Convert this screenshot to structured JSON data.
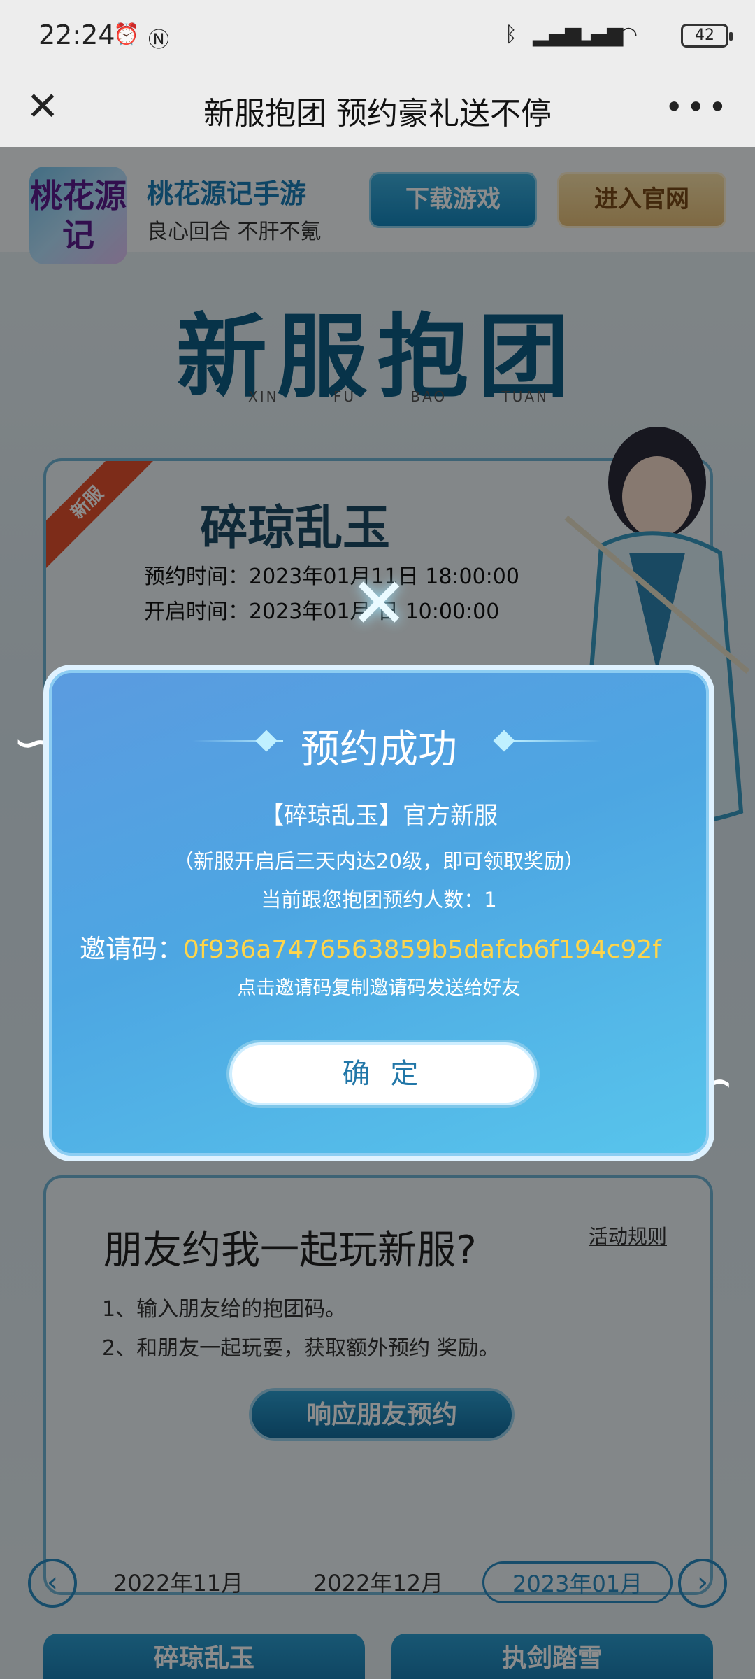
{
  "status_bar": {
    "time": "22:24",
    "battery": "42"
  },
  "nav": {
    "title": "新服抱团 预约豪礼送不停"
  },
  "game": {
    "logo_text": "桃花源记",
    "name": "桃花源记手游",
    "slogan": "良心回合 不肝不氪",
    "download_label": "下载游戏",
    "official_label": "进入官网"
  },
  "hero": {
    "title": "新服抱团",
    "sub": [
      "XIN",
      "FU",
      "BAO",
      "TUAN"
    ]
  },
  "server_card": {
    "ribbon": "新服",
    "name": "碎琼乱玉",
    "reserve_time": "预约时间：2023年01月11日 18:00:00",
    "open_time": "开启时间：2023年01月 日 10:00:00"
  },
  "friend_card": {
    "title": "朋友约我一起玩新服?",
    "rules_link": "活动规则",
    "rule1": "1、输入朋友给的抱团码。",
    "rule2": "2、和朋友一起玩耍，获取额外预约 奖励。",
    "respond_label": "响应朋友预约"
  },
  "months": {
    "items": [
      "2022年11月",
      "2022年12月",
      "2023年01月"
    ],
    "selected_index": 2
  },
  "bottom_cards": [
    "碎琼乱玉",
    "执剑踏雪"
  ],
  "modal": {
    "title": "预约成功",
    "line1": "【碎琼乱玉】官方新服",
    "line2": "（新服开启后三天内达20级，即可领取奖励）",
    "line3": "当前跟您抱团预约人数：1",
    "code_label": "邀请码：",
    "code_value": "0f936a7476563859b5dafcb6f194c92f",
    "hint": "点击邀请码复制邀请码发送给好友",
    "confirm_label": "确 定"
  },
  "colors": {
    "accent": "#2a8cc3",
    "code_yellow": "#ffd54a",
    "modal_blue": "#4da6e2"
  }
}
